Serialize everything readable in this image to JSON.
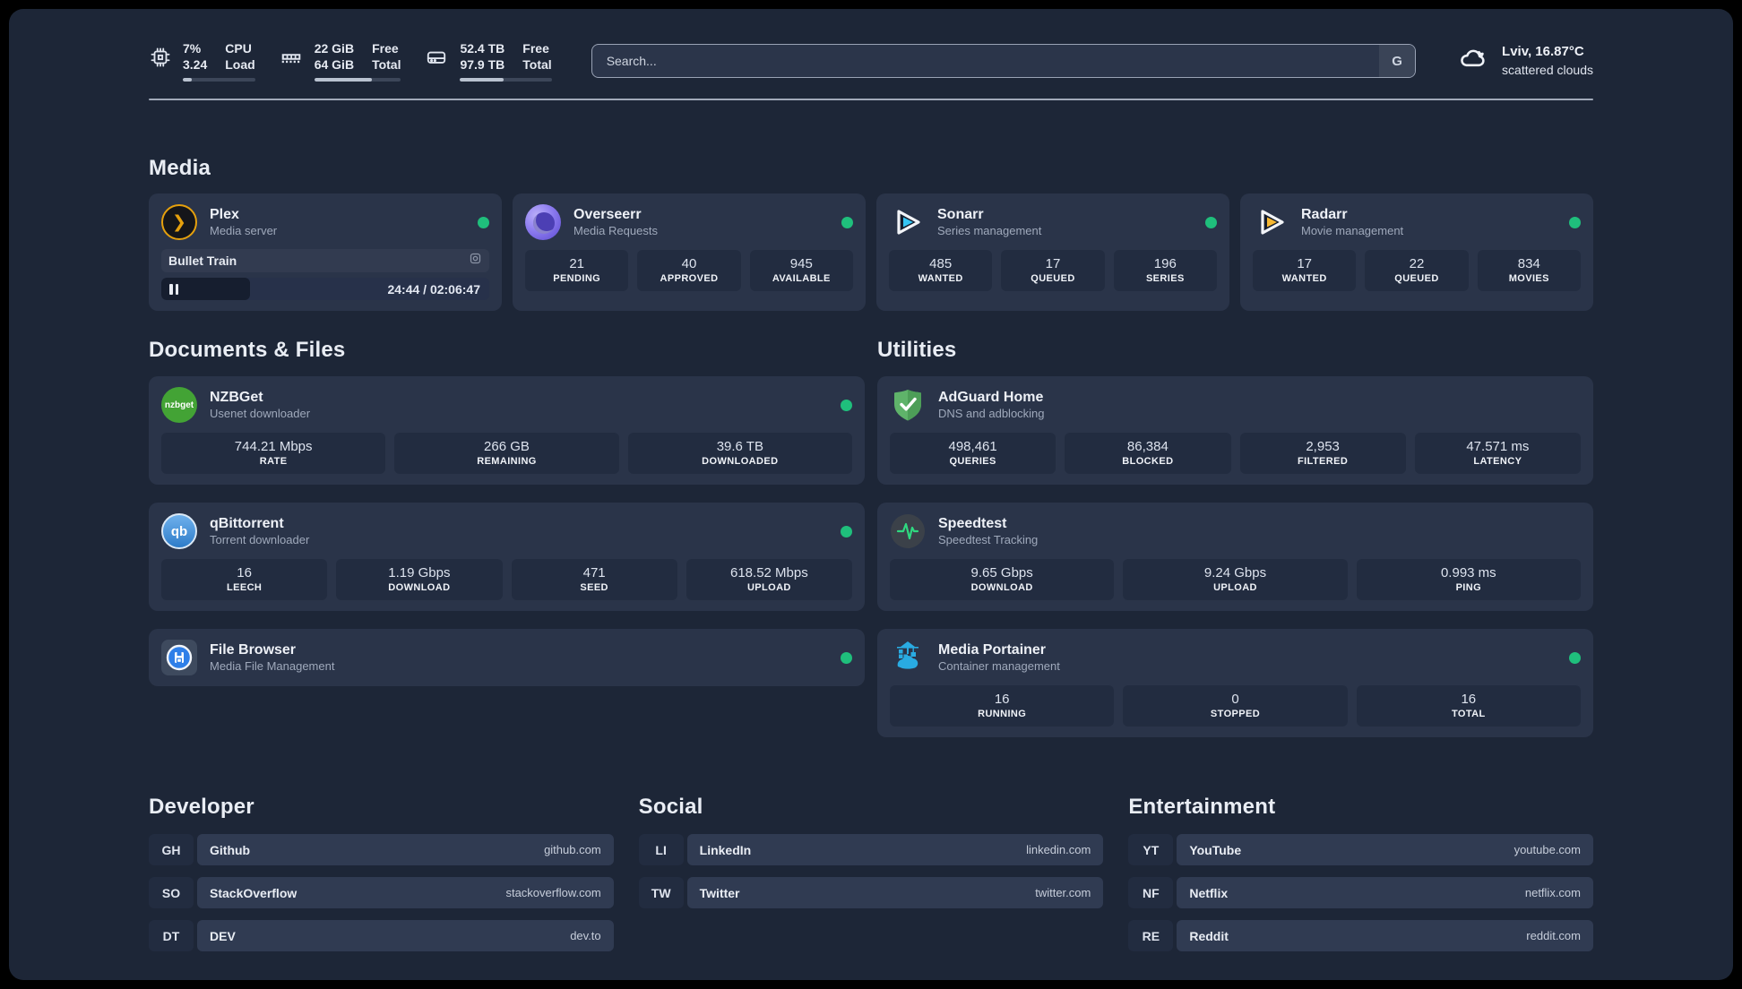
{
  "colors": {
    "status_online": "#1fbf7c",
    "accent": "#e5a00d"
  },
  "system_bar": {
    "cpu": {
      "value_top": "7%",
      "value_bottom": "3.24",
      "label_top": "CPU",
      "label_bottom": "Load",
      "progress": 12
    },
    "ram": {
      "value_top": "22 GiB",
      "value_bottom": "64 GiB",
      "label_top": "Free",
      "label_bottom": "Total",
      "progress": 66
    },
    "disk": {
      "value_top": "52.4 TB",
      "value_bottom": "97.9 TB",
      "label_top": "Free",
      "label_bottom": "Total",
      "progress": 47
    },
    "search": {
      "placeholder": "Search...",
      "engine_label": "G"
    },
    "weather": {
      "location_temp": "Lviv, 16.87°C",
      "condition": "scattered clouds"
    }
  },
  "section_titles": {
    "media": "Media",
    "documents": "Documents & Files",
    "utilities": "Utilities",
    "developer": "Developer",
    "social": "Social",
    "entertainment": "Entertainment"
  },
  "apps": {
    "plex": {
      "name": "Plex",
      "desc": "Media server",
      "icon_glyph": "❯",
      "now_playing": "Bullet Train",
      "time": "24:44 / 02:06:47",
      "progress": 27
    },
    "overseerr": {
      "name": "Overseerr",
      "desc": "Media Requests",
      "stats": [
        {
          "value": "21",
          "label": "PENDING"
        },
        {
          "value": "40",
          "label": "APPROVED"
        },
        {
          "value": "945",
          "label": "AVAILABLE"
        }
      ]
    },
    "sonarr": {
      "name": "Sonarr",
      "desc": "Series management",
      "stats": [
        {
          "value": "485",
          "label": "WANTED"
        },
        {
          "value": "17",
          "label": "QUEUED"
        },
        {
          "value": "196",
          "label": "SERIES"
        }
      ]
    },
    "radarr": {
      "name": "Radarr",
      "desc": "Movie management",
      "stats": [
        {
          "value": "17",
          "label": "WANTED"
        },
        {
          "value": "22",
          "label": "QUEUED"
        },
        {
          "value": "834",
          "label": "MOVIES"
        }
      ]
    },
    "nzbget": {
      "name": "NZBGet",
      "desc": "Usenet downloader",
      "icon_text": "nzbget",
      "stats": [
        {
          "value": "744.21 Mbps",
          "label": "RATE"
        },
        {
          "value": "266 GB",
          "label": "REMAINING"
        },
        {
          "value": "39.6 TB",
          "label": "DOWNLOADED"
        }
      ]
    },
    "qbittorrent": {
      "name": "qBittorrent",
      "desc": "Torrent downloader",
      "icon_text": "qb",
      "stats": [
        {
          "value": "16",
          "label": "LEECH"
        },
        {
          "value": "1.19 Gbps",
          "label": "DOWNLOAD"
        },
        {
          "value": "471",
          "label": "SEED"
        },
        {
          "value": "618.52 Mbps",
          "label": "UPLOAD"
        }
      ]
    },
    "filebrowser": {
      "name": "File Browser",
      "desc": "Media File Management"
    },
    "adguard": {
      "name": "AdGuard Home",
      "desc": "DNS and adblocking",
      "stats": [
        {
          "value": "498,461",
          "label": "QUERIES"
        },
        {
          "value": "86,384",
          "label": "BLOCKED"
        },
        {
          "value": "2,953",
          "label": "FILTERED"
        },
        {
          "value": "47.571 ms",
          "label": "LATENCY"
        }
      ]
    },
    "speedtest": {
      "name": "Speedtest",
      "desc": "Speedtest Tracking",
      "stats": [
        {
          "value": "9.65 Gbps",
          "label": "DOWNLOAD"
        },
        {
          "value": "9.24 Gbps",
          "label": "UPLOAD"
        },
        {
          "value": "0.993 ms",
          "label": "PING"
        }
      ]
    },
    "portainer": {
      "name": "Media Portainer",
      "desc": "Container management",
      "stats": [
        {
          "value": "16",
          "label": "RUNNING"
        },
        {
          "value": "0",
          "label": "STOPPED"
        },
        {
          "value": "16",
          "label": "TOTAL"
        }
      ]
    }
  },
  "links": {
    "developer": [
      {
        "abbr": "GH",
        "name": "Github",
        "url": "github.com"
      },
      {
        "abbr": "SO",
        "name": "StackOverflow",
        "url": "stackoverflow.com"
      },
      {
        "abbr": "DT",
        "name": "DEV",
        "url": "dev.to"
      }
    ],
    "social": [
      {
        "abbr": "LI",
        "name": "LinkedIn",
        "url": "linkedin.com"
      },
      {
        "abbr": "TW",
        "name": "Twitter",
        "url": "twitter.com"
      }
    ],
    "entertainment": [
      {
        "abbr": "YT",
        "name": "YouTube",
        "url": "youtube.com"
      },
      {
        "abbr": "NF",
        "name": "Netflix",
        "url": "netflix.com"
      },
      {
        "abbr": "RE",
        "name": "Reddit",
        "url": "reddit.com"
      }
    ]
  }
}
